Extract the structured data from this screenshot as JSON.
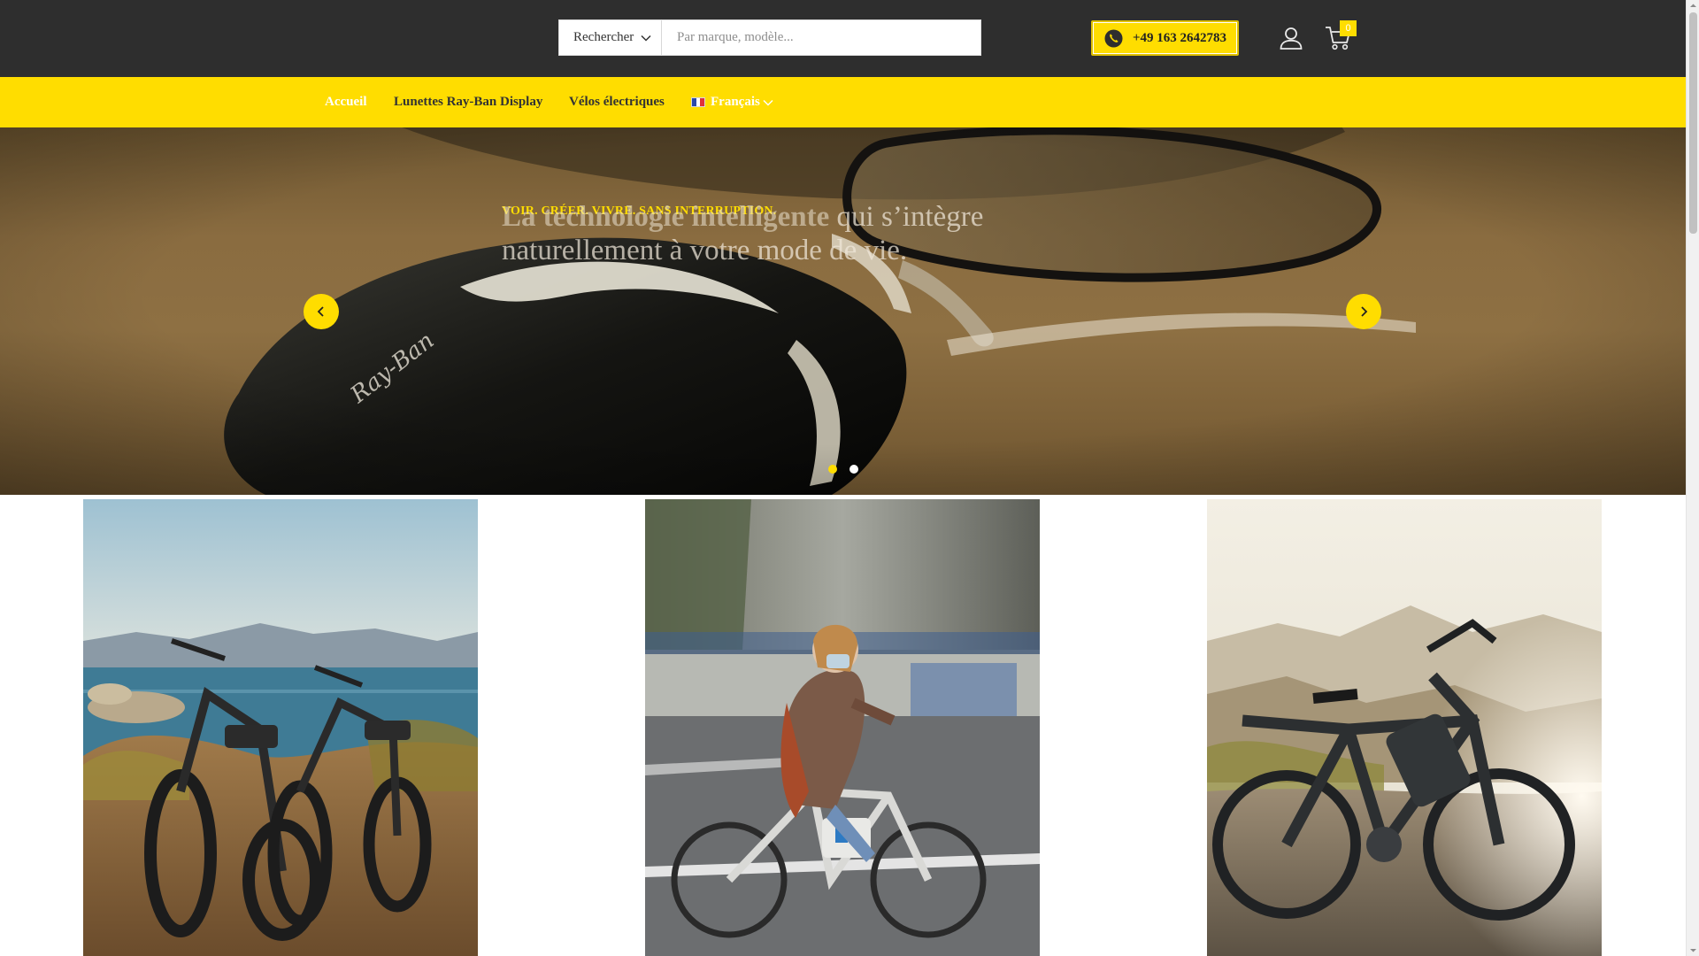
{
  "header": {
    "search": {
      "category_label": "Rechercher",
      "placeholder": "Par marque, modèle...",
      "value": ""
    },
    "phone": {
      "number": "+49 163 2642783",
      "icon": "phone-icon"
    },
    "account_icon": "user-icon",
    "cart": {
      "icon": "cart-icon",
      "count": "0"
    }
  },
  "nav": {
    "items": [
      {
        "label": "Accueil",
        "active": true
      },
      {
        "label": "Lunettes Ray-Ban Display",
        "active": false
      },
      {
        "label": "Vélos électriques",
        "active": false
      }
    ],
    "language": {
      "label": "Français",
      "flag": "fr-flag-icon"
    }
  },
  "hero": {
    "kicker": "VOIR. CRÉER. VIVRE. SANS INTERRUPTION.",
    "headline_bold": "La technologie intelligente",
    "headline_rest": " qui s’intègre naturellement à votre mode de vie.",
    "slides": 2,
    "active_slide": 1,
    "image_text": "Ray-Ban"
  },
  "tiles": [
    {
      "subject": "two e-bikes by a lake"
    },
    {
      "subject": "woman riding an e-bike in the city"
    },
    {
      "subject": "e-bike in the mountains at sunset"
    }
  ],
  "colors": {
    "accent": "#ffdd00",
    "header_bg": "#2e2e2e",
    "nav_text": "#333333"
  }
}
